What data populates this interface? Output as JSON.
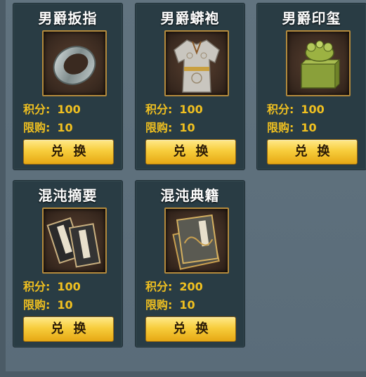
{
  "labels": {
    "points": "积分:",
    "limit": "限购:",
    "exchange": "兑换"
  },
  "items": [
    {
      "name": "男爵扳指",
      "points": "100",
      "limit": "10",
      "icon": "jade-ring-icon"
    },
    {
      "name": "男爵蟒袍",
      "points": "100",
      "limit": "10",
      "icon": "python-robe-icon"
    },
    {
      "name": "男爵印玺",
      "points": "100",
      "limit": "10",
      "icon": "jade-seal-icon"
    },
    {
      "name": "混沌摘要",
      "points": "100",
      "limit": "10",
      "icon": "chaos-summary-books-icon"
    },
    {
      "name": "混沌典籍",
      "points": "200",
      "limit": "10",
      "icon": "chaos-classic-books-icon"
    }
  ]
}
